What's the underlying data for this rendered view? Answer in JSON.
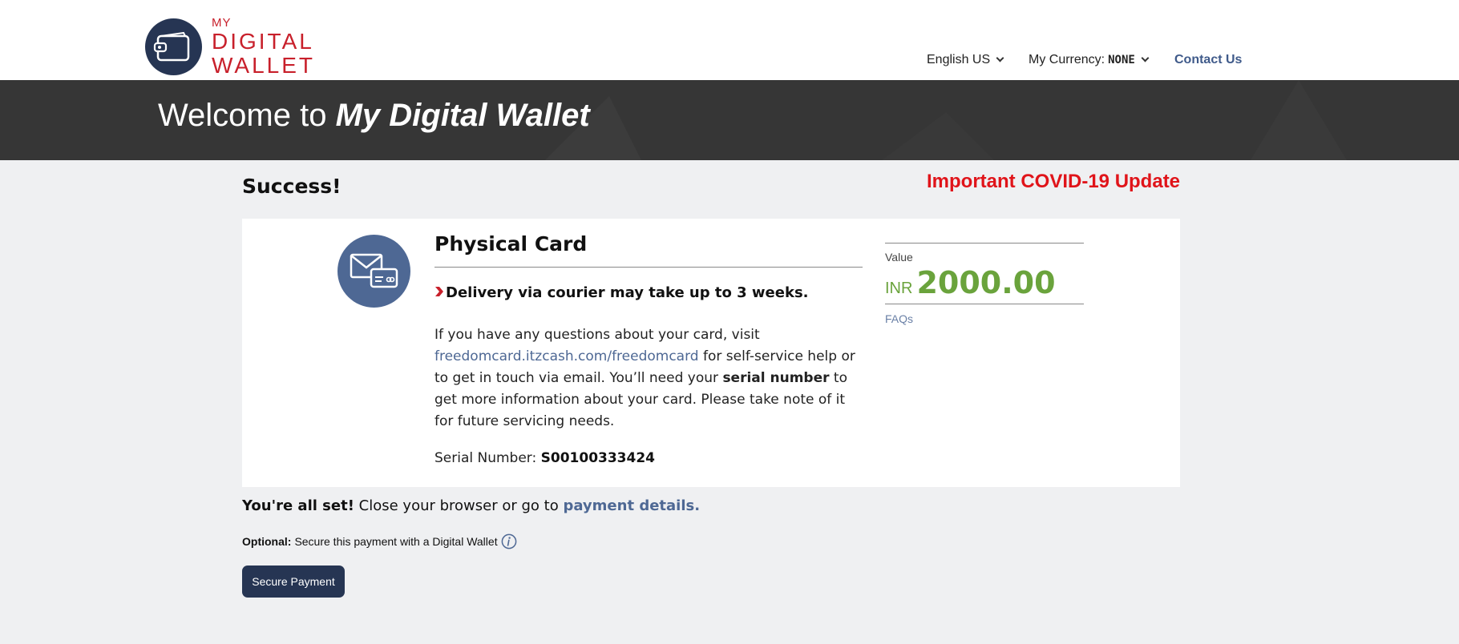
{
  "header": {
    "logo": {
      "line1": "MY",
      "line2": "DIGITAL",
      "line3": "WALLET"
    },
    "language": {
      "label": "English US"
    },
    "currency": {
      "label": "My Currency:",
      "value": "NONE"
    },
    "contact": "Contact Us"
  },
  "banner": {
    "welcome_prefix": "Welcome to",
    "welcome_brand": "My Digital Wallet"
  },
  "main": {
    "success_title": "Success!",
    "covid_link": "Important COVID-19 Update",
    "card": {
      "title": "Physical Card",
      "delivery_note": "Delivery via courier may take up to 3 weeks.",
      "desc_part1": "If you have any questions about your card, visit",
      "desc_link": "freedomcard.itzcash.com/freedomcard",
      "desc_part2": "for self-service help or to get in touch via email. You’ll need your",
      "desc_bold": "serial number",
      "desc_part3": "to get more information about your card. Please take note of it for future servicing needs.",
      "serial_label": "Serial Number:",
      "serial_value": "S00100333424",
      "value_label": "Value",
      "value_currency": "INR",
      "value_amount": "2000.00",
      "faqs": "FAQs"
    },
    "allset_bold": "You're all set!",
    "allset_text": "Close your browser or go to",
    "allset_link": "payment details.",
    "optional_label": "Optional:",
    "optional_text": "Secure this payment with a Digital Wallet",
    "secure_button": "Secure Payment"
  },
  "colors": {
    "brand_navy": "#263553",
    "brand_red": "#c8202b",
    "accent_blue": "#4e6894",
    "value_green": "#6aa33c",
    "covid_red": "#e0141a",
    "banner_bg": "#363636",
    "page_bg": "#eff0f2"
  },
  "icons": [
    "wallet-icon",
    "chevron-down-icon",
    "envelope-card-icon",
    "red-arrow-icon",
    "info-icon"
  ]
}
